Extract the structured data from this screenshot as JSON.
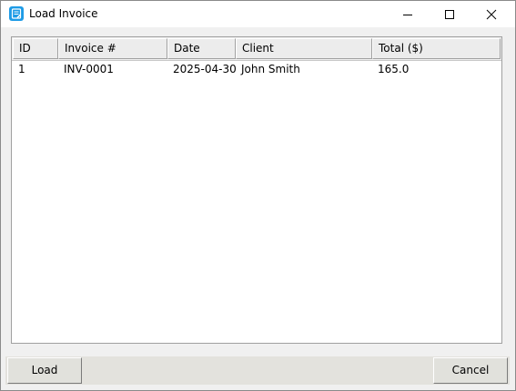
{
  "window": {
    "title": "Load Invoice",
    "icon": "invoice-app-icon"
  },
  "table": {
    "columns": [
      "ID",
      "Invoice #",
      "Date",
      "Client",
      "Total ($)"
    ],
    "rows": [
      [
        "1",
        "INV-0001",
        "2025-04-30",
        "John Smith",
        "165.0"
      ]
    ]
  },
  "buttons": {
    "load_label": "Load",
    "cancel_label": "Cancel"
  },
  "colors": {
    "accent": "#1e9be6",
    "window_bg": "#f0f0f0",
    "footer_bg": "#e3e2dd"
  }
}
